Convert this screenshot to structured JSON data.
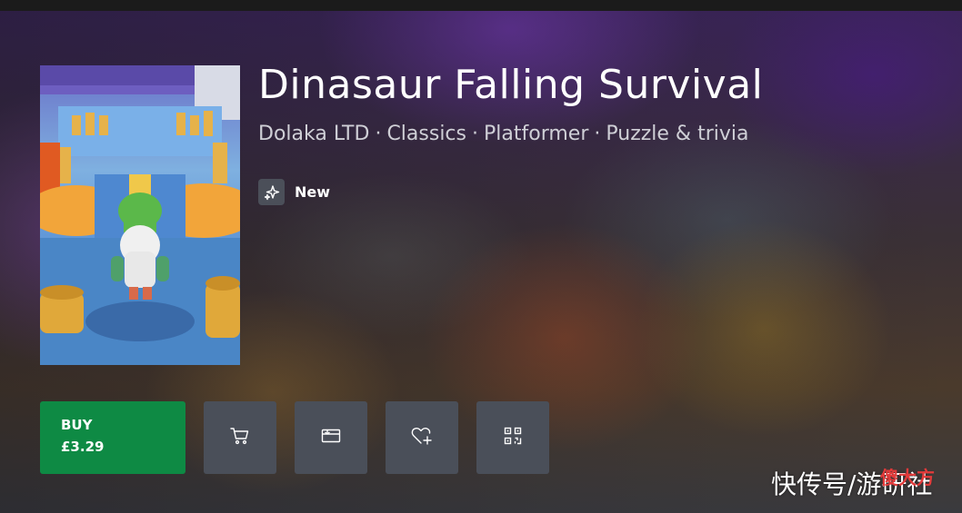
{
  "game": {
    "title": "Dinasaur Falling Survival",
    "publisher": "Dolaka LTD",
    "categories": [
      "Classics",
      "Platformer",
      "Puzzle & trivia"
    ],
    "separator": "·",
    "badge": {
      "label": "New",
      "icon": "sparkle-icon"
    }
  },
  "purchase": {
    "buy_label": "BUY",
    "price": "£3.29"
  },
  "actions": [
    {
      "name": "add-to-cart",
      "icon": "cart-icon"
    },
    {
      "name": "redeem-code",
      "icon": "gift-card-icon"
    },
    {
      "name": "add-to-wishlist",
      "icon": "heart-plus-icon"
    },
    {
      "name": "share-qr",
      "icon": "qr-code-icon"
    }
  ],
  "watermark": {
    "text": "快传号/游研社",
    "stamp": "傻大方"
  },
  "colors": {
    "buy_green": "#0e8a44",
    "action_grey": "#4a4f59",
    "subtitle_grey": "#cfcfd6"
  }
}
